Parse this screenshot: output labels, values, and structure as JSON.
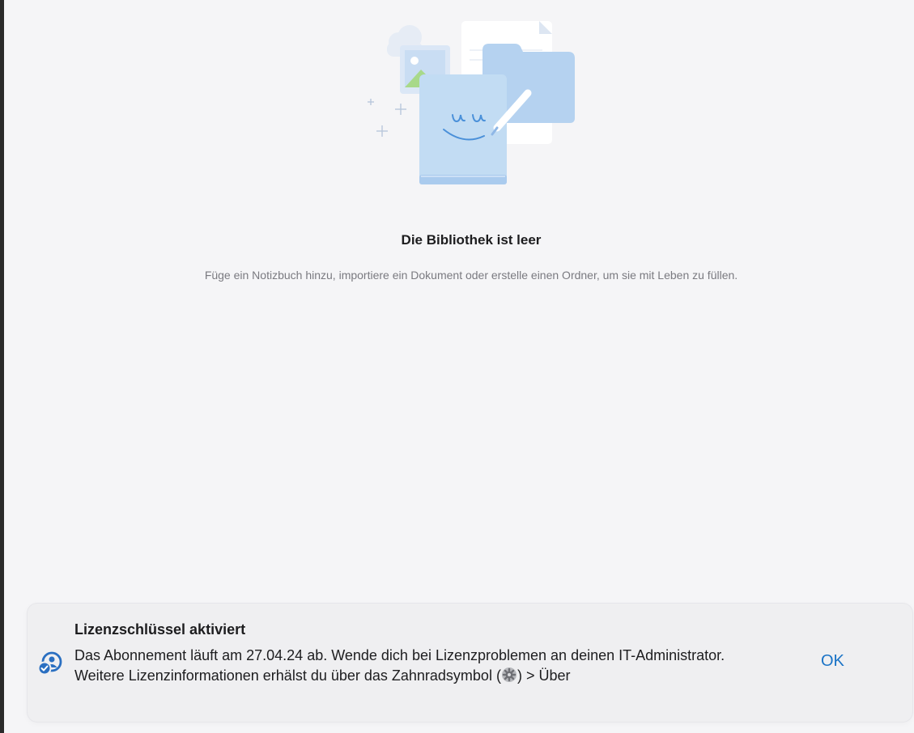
{
  "empty_state": {
    "title": "Die Bibliothek ist leer",
    "subtitle": "Füge ein Notizbuch hinzu, importiere ein Dokument oder erstelle einen Ordner, um sie mit Leben zu füllen.",
    "illustration_icon": "library-empty-illustration"
  },
  "toast": {
    "icon": "license-user-check-icon",
    "title": "Lizenzschlüssel aktiviert",
    "message_part1": "Das Abonnement läuft am 27.04.24 ab. Wende dich bei Lizenzproblemen an deinen IT-Administrator. Weitere Lizenzinformationen erhälst du über das Zahnradsymbol (",
    "gear_icon": "gear-icon",
    "message_part2": ") > Über",
    "ok_label": "OK"
  },
  "colors": {
    "background": "#f5f5f7",
    "accent": "#1a73c6",
    "toast_background": "#efeff1"
  }
}
